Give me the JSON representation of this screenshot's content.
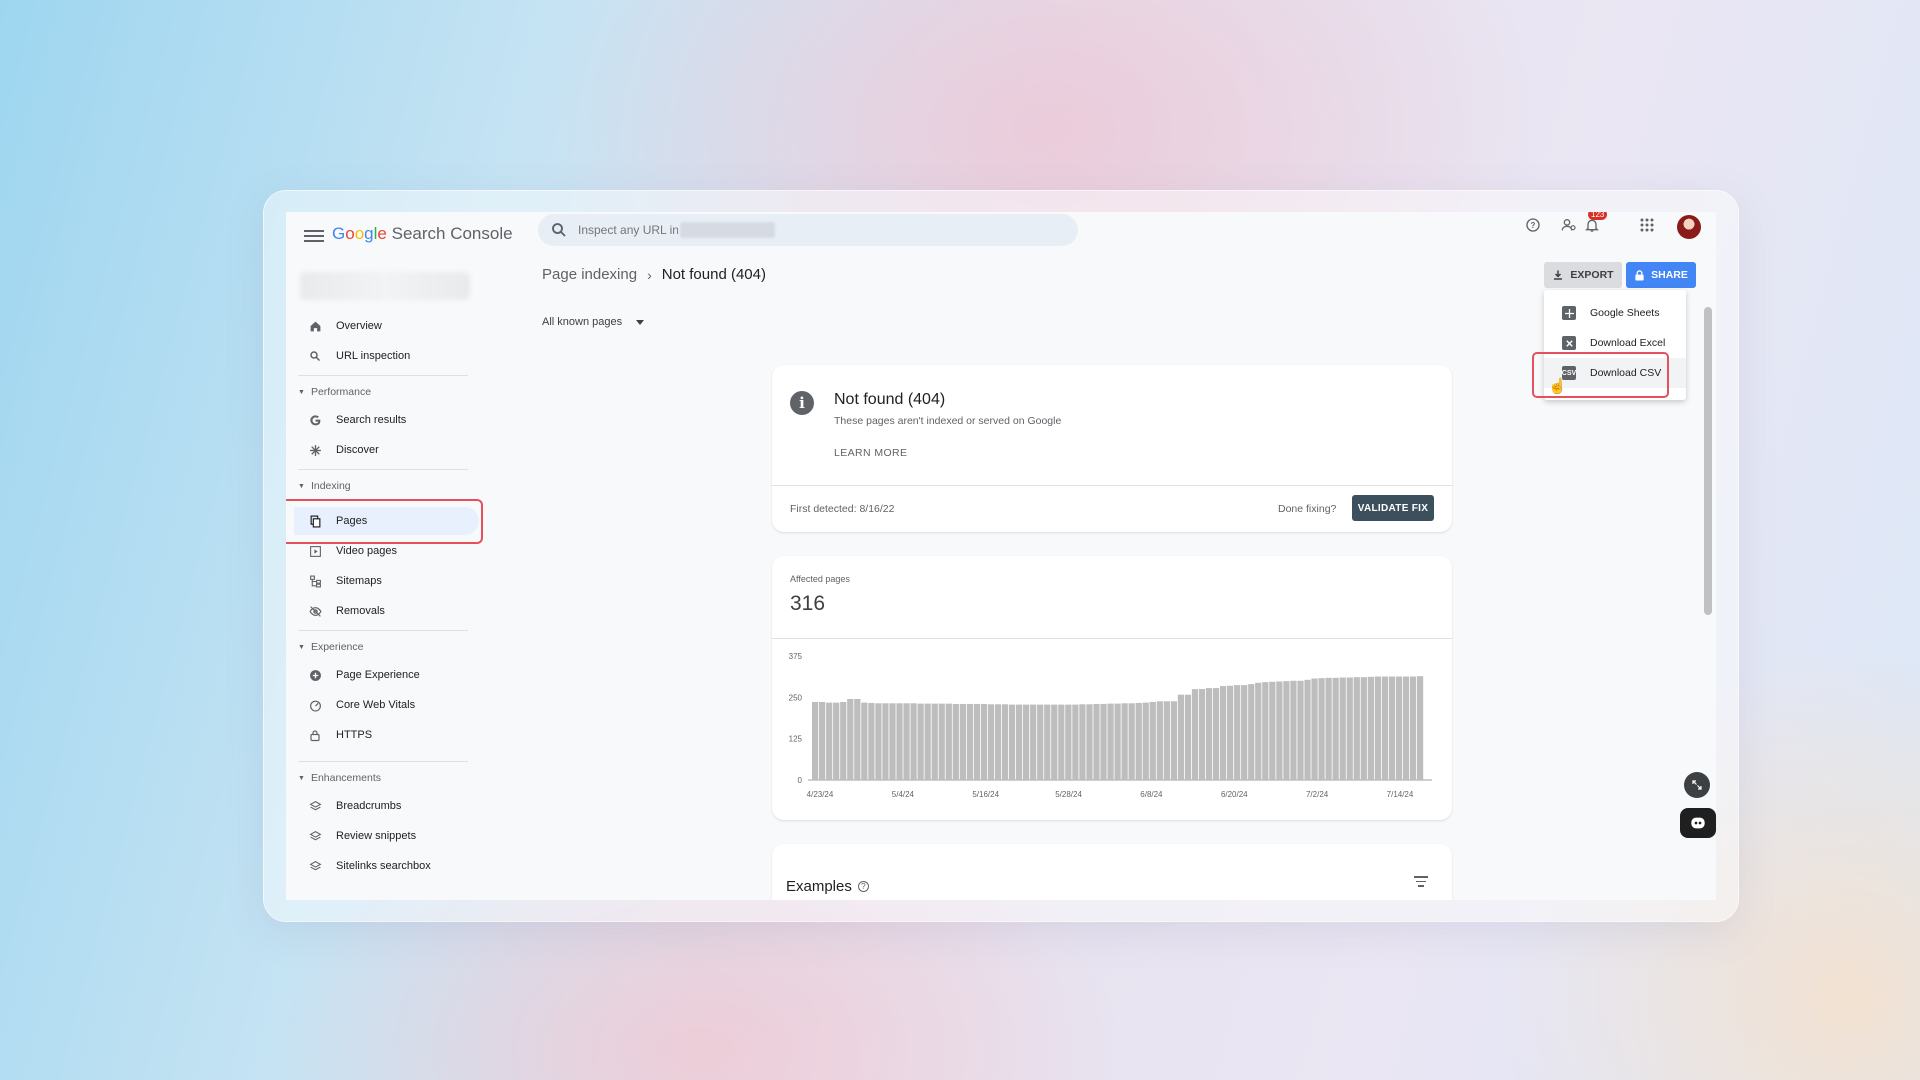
{
  "app": {
    "logo_google": "Google",
    "logo_product": " Search Console"
  },
  "search": {
    "placeholder": "Inspect any URL in"
  },
  "header": {
    "notification_count": "123"
  },
  "sidebar": {
    "top_items": [
      {
        "label": "Overview",
        "icon": "home-icon"
      },
      {
        "label": "URL inspection",
        "icon": "search-icon"
      }
    ],
    "sections": [
      {
        "title": "Performance",
        "items": [
          {
            "label": "Search results",
            "icon": "google-g-icon"
          },
          {
            "label": "Discover",
            "icon": "asterisk-icon"
          }
        ]
      },
      {
        "title": "Indexing",
        "items": [
          {
            "label": "Pages",
            "icon": "pages-icon",
            "active": true
          },
          {
            "label": "Video pages",
            "icon": "video-pages-icon"
          },
          {
            "label": "Sitemaps",
            "icon": "sitemap-icon"
          },
          {
            "label": "Removals",
            "icon": "eye-off-icon"
          }
        ]
      },
      {
        "title": "Experience",
        "items": [
          {
            "label": "Page Experience",
            "icon": "plus-circle-icon"
          },
          {
            "label": "Core Web Vitals",
            "icon": "gauge-icon"
          },
          {
            "label": "HTTPS",
            "icon": "lock-icon"
          }
        ]
      },
      {
        "title": "Enhancements",
        "items": [
          {
            "label": "Breadcrumbs",
            "icon": "layers-icon"
          },
          {
            "label": "Review snippets",
            "icon": "layers-icon"
          },
          {
            "label": "Sitelinks searchbox",
            "icon": "layers-icon"
          }
        ]
      }
    ]
  },
  "breadcrumb": {
    "parent": "Page indexing",
    "separator": "›",
    "current": "Not found (404)"
  },
  "filter": {
    "selected": "All known pages"
  },
  "toolbar": {
    "export_label": "EXPORT",
    "share_label": "SHARE"
  },
  "export_menu": {
    "items": [
      {
        "label": "Google Sheets",
        "icon": "sheets-icon",
        "color": "#5f6368"
      },
      {
        "label": "Download Excel",
        "icon": "excel-icon",
        "color": "#5f6368"
      },
      {
        "label": "Download CSV",
        "icon": "csv-icon",
        "color": "#5f6368",
        "csv_text": "CSV"
      }
    ]
  },
  "issue_card": {
    "title": "Not found (404)",
    "subtitle": "These pages aren't indexed or served on Google",
    "learn_more": "LEARN MORE",
    "first_detected": "First detected: 8/16/22",
    "done_fixing": "Done fixing?",
    "validate_label": "VALIDATE FIX"
  },
  "affected_card": {
    "label": "Affected pages",
    "value": "316"
  },
  "chart_data": {
    "type": "bar",
    "xlabel": "",
    "ylabel": "",
    "ylim": [
      0,
      375
    ],
    "yticks": [
      "375",
      "250",
      "125",
      "0"
    ],
    "xticks": [
      "4/23/24",
      "5/4/24",
      "5/16/24",
      "5/28/24",
      "6/8/24",
      "6/20/24",
      "7/2/24",
      "7/14/24"
    ],
    "bar_color": "#bdbdbd",
    "values": [
      236,
      236,
      234,
      234,
      236,
      245,
      245,
      234,
      233,
      232,
      232,
      232,
      232,
      232,
      232,
      231,
      231,
      231,
      231,
      231,
      230,
      230,
      230,
      230,
      230,
      229,
      229,
      229,
      228,
      228,
      228,
      228,
      228,
      228,
      228,
      228,
      228,
      228,
      229,
      229,
      230,
      230,
      231,
      231,
      232,
      232,
      233,
      234,
      236,
      238,
      238,
      238,
      258,
      258,
      275,
      275,
      278,
      278,
      284,
      285,
      287,
      287,
      290,
      294,
      296,
      297,
      298,
      299,
      300,
      300,
      303,
      307,
      308,
      309,
      309,
      310,
      310,
      311,
      311,
      312,
      313,
      313,
      313,
      313,
      313,
      313,
      314
    ]
  },
  "examples_card": {
    "title": "Examples",
    "help": "?"
  }
}
